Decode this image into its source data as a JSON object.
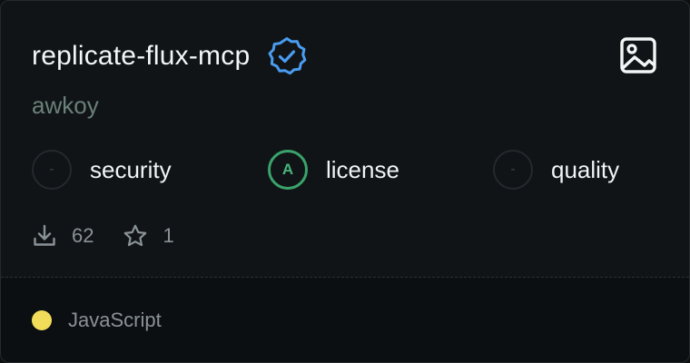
{
  "server": {
    "name": "replicate-flux-mcp",
    "author": "awkoy",
    "verified_icon": "verified-badge-icon",
    "type_icon": "image-icon"
  },
  "metrics": [
    {
      "grade": "-",
      "label": "security"
    },
    {
      "grade": "A",
      "label": "license"
    },
    {
      "grade": "-",
      "label": "quality"
    }
  ],
  "stats": {
    "downloads": "62",
    "stars": "1"
  },
  "language": {
    "name": "JavaScript",
    "color": "#f1dd5a"
  },
  "colors": {
    "verified": "#4a9cf0",
    "grade_good": "#3aa36a"
  }
}
